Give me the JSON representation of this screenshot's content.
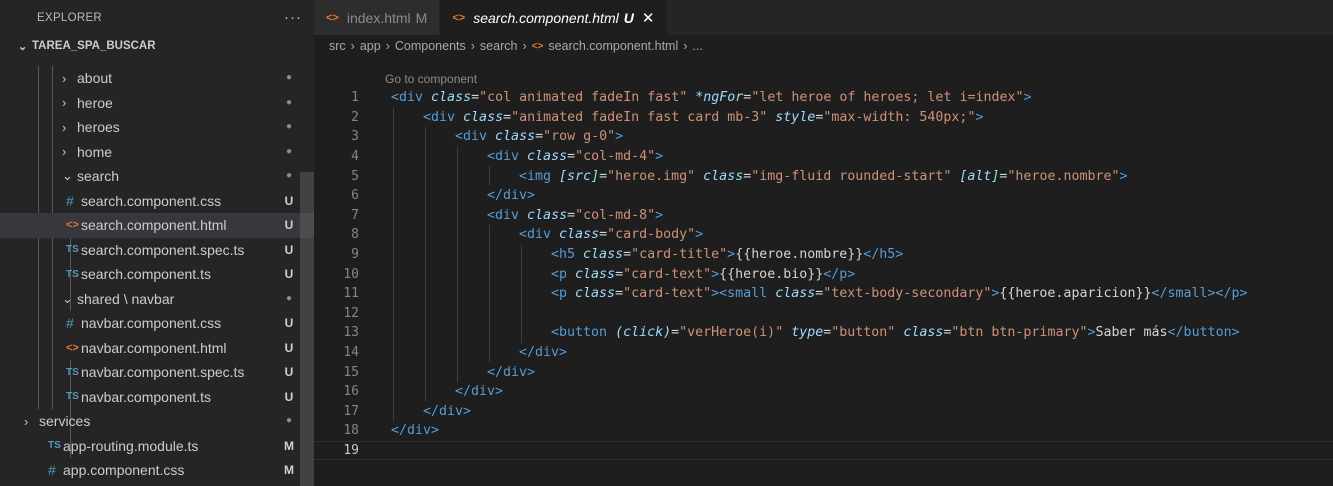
{
  "explorer": {
    "title": "EXPLORER",
    "more": "···",
    "workspace": "TAREA_SPA_BUSCAR"
  },
  "tree": [
    {
      "name": "about",
      "kind": "folder",
      "level": 1,
      "status": "dot",
      "open": false
    },
    {
      "name": "heroe",
      "kind": "folder",
      "level": 1,
      "status": "dot",
      "open": false
    },
    {
      "name": "heroes",
      "kind": "folder",
      "level": 1,
      "status": "dot",
      "open": false
    },
    {
      "name": "home",
      "kind": "folder",
      "level": 1,
      "status": "dot",
      "open": false
    },
    {
      "name": "search",
      "kind": "folder",
      "level": 1,
      "status": "dot",
      "open": true
    },
    {
      "name": "search.component.css",
      "kind": "css",
      "level": 2,
      "status": "U"
    },
    {
      "name": "search.component.html",
      "kind": "html",
      "level": 2,
      "status": "U",
      "selected": true
    },
    {
      "name": "search.component.spec.ts",
      "kind": "ts",
      "level": 2,
      "status": "U"
    },
    {
      "name": "search.component.ts",
      "kind": "ts",
      "level": 2,
      "status": "U"
    },
    {
      "name": "shared \\ navbar",
      "kind": "folder",
      "level": 1,
      "status": "dot",
      "open": true
    },
    {
      "name": "navbar.component.css",
      "kind": "css",
      "level": 2,
      "status": "U"
    },
    {
      "name": "navbar.component.html",
      "kind": "html",
      "level": 2,
      "status": "U"
    },
    {
      "name": "navbar.component.spec.ts",
      "kind": "ts",
      "level": 2,
      "status": "U"
    },
    {
      "name": "navbar.component.ts",
      "kind": "ts",
      "level": 2,
      "status": "U"
    },
    {
      "name": "services",
      "kind": "folder",
      "level": 0,
      "status": "dot",
      "open": false
    },
    {
      "name": "app-routing.module.ts",
      "kind": "ts",
      "level": -1,
      "status": "M"
    },
    {
      "name": "app.component.css",
      "kind": "css",
      "level": -1,
      "status": "M"
    }
  ],
  "tabs": [
    {
      "label": "index.html",
      "badge": "M",
      "active": false
    },
    {
      "label": "search.component.html",
      "badge": "U",
      "active": true,
      "close": "✕"
    }
  ],
  "breadcrumb": [
    "src",
    "app",
    "Components",
    "search",
    "search.component.html",
    "..."
  ],
  "codelens": "Go to component",
  "icons": {
    "ts": "TS",
    "css": "#",
    "html": "<>",
    "chevron_right": "›",
    "chevron_down": "⌄",
    "dot": "●",
    "close": "✕"
  },
  "code_lines": [
    {
      "n": "1",
      "indent": 0,
      "tokens": [
        [
          "tg",
          "<div"
        ],
        [
          "tx",
          " "
        ],
        [
          "at",
          "class"
        ],
        [
          "tx",
          "="
        ],
        [
          "st",
          "\"col animated fadeIn fast\""
        ],
        [
          "tx",
          " "
        ],
        [
          "at",
          "*ngFor"
        ],
        [
          "tx",
          "="
        ],
        [
          "st",
          "\"let heroe of heroes; let i=index\""
        ],
        [
          "tg",
          ">"
        ]
      ]
    },
    {
      "n": "2",
      "indent": 1,
      "tokens": [
        [
          "tg",
          "<div"
        ],
        [
          "tx",
          " "
        ],
        [
          "at",
          "class"
        ],
        [
          "tx",
          "="
        ],
        [
          "st",
          "\"animated fadeIn fast card mb-3\""
        ],
        [
          "tx",
          " "
        ],
        [
          "at",
          "style"
        ],
        [
          "tx",
          "="
        ],
        [
          "st",
          "\"max-width: 540px;\""
        ],
        [
          "tg",
          ">"
        ]
      ]
    },
    {
      "n": "3",
      "indent": 2,
      "tokens": [
        [
          "tg",
          "<div"
        ],
        [
          "tx",
          " "
        ],
        [
          "at",
          "class"
        ],
        [
          "tx",
          "="
        ],
        [
          "st",
          "\"row g-0\""
        ],
        [
          "tg",
          ">"
        ]
      ]
    },
    {
      "n": "4",
      "indent": 3,
      "tokens": [
        [
          "tg",
          "<div"
        ],
        [
          "tx",
          " "
        ],
        [
          "at",
          "class"
        ],
        [
          "tx",
          "="
        ],
        [
          "st",
          "\"col-md-4\""
        ],
        [
          "tg",
          ">"
        ]
      ]
    },
    {
      "n": "5",
      "indent": 4,
      "tokens": [
        [
          "tg",
          "<img"
        ],
        [
          "tx",
          " "
        ],
        [
          "at",
          "[src]"
        ],
        [
          "tx",
          "="
        ],
        [
          "st",
          "\"heroe.img\""
        ],
        [
          "tx",
          " "
        ],
        [
          "at",
          "class"
        ],
        [
          "tx",
          "="
        ],
        [
          "st",
          "\"img-fluid rounded-start\""
        ],
        [
          "tx",
          " "
        ],
        [
          "at",
          "[alt]"
        ],
        [
          "tx",
          "="
        ],
        [
          "st",
          "\"heroe.nombre\""
        ],
        [
          "tg",
          ">"
        ]
      ]
    },
    {
      "n": "6",
      "indent": 3,
      "tokens": [
        [
          "tg",
          "</div>"
        ]
      ]
    },
    {
      "n": "7",
      "indent": 3,
      "tokens": [
        [
          "tg",
          "<div"
        ],
        [
          "tx",
          " "
        ],
        [
          "at",
          "class"
        ],
        [
          "tx",
          "="
        ],
        [
          "st",
          "\"col-md-8\""
        ],
        [
          "tg",
          ">"
        ]
      ]
    },
    {
      "n": "8",
      "indent": 4,
      "tokens": [
        [
          "tg",
          "<div"
        ],
        [
          "tx",
          " "
        ],
        [
          "at",
          "class"
        ],
        [
          "tx",
          "="
        ],
        [
          "st",
          "\"card-body\""
        ],
        [
          "tg",
          ">"
        ]
      ]
    },
    {
      "n": "9",
      "indent": 5,
      "tokens": [
        [
          "tg",
          "<h5"
        ],
        [
          "tx",
          " "
        ],
        [
          "at",
          "class"
        ],
        [
          "tx",
          "="
        ],
        [
          "st",
          "\"card-title\""
        ],
        [
          "tg",
          ">"
        ],
        [
          "tx",
          "{{heroe.nombre}}"
        ],
        [
          "tg",
          "</h5>"
        ]
      ]
    },
    {
      "n": "10",
      "indent": 5,
      "tokens": [
        [
          "tg",
          "<p"
        ],
        [
          "tx",
          " "
        ],
        [
          "at",
          "class"
        ],
        [
          "tx",
          "="
        ],
        [
          "st",
          "\"card-text\""
        ],
        [
          "tg",
          ">"
        ],
        [
          "tx",
          "{{heroe.bio}}"
        ],
        [
          "tg",
          "</p>"
        ]
      ]
    },
    {
      "n": "11",
      "indent": 5,
      "tokens": [
        [
          "tg",
          "<p"
        ],
        [
          "tx",
          " "
        ],
        [
          "at",
          "class"
        ],
        [
          "tx",
          "="
        ],
        [
          "st",
          "\"card-text\""
        ],
        [
          "tg",
          "><small"
        ],
        [
          "tx",
          " "
        ],
        [
          "at",
          "class"
        ],
        [
          "tx",
          "="
        ],
        [
          "st",
          "\"text-body-secondary\""
        ],
        [
          "tg",
          ">"
        ],
        [
          "tx",
          "{{heroe.aparicion}}"
        ],
        [
          "tg",
          "</small></p>"
        ]
      ]
    },
    {
      "n": "12",
      "indent": 0,
      "tokens": []
    },
    {
      "n": "13",
      "indent": 5,
      "tokens": [
        [
          "tg",
          "<button"
        ],
        [
          "tx",
          " "
        ],
        [
          "at",
          "(click)"
        ],
        [
          "tx",
          "="
        ],
        [
          "st",
          "\"verHeroe(i)\""
        ],
        [
          "tx",
          " "
        ],
        [
          "at",
          "type"
        ],
        [
          "tx",
          "="
        ],
        [
          "st",
          "\"button\""
        ],
        [
          "tx",
          " "
        ],
        [
          "at",
          "class"
        ],
        [
          "tx",
          "="
        ],
        [
          "st",
          "\"btn btn-primary\""
        ],
        [
          "tg",
          ">"
        ],
        [
          "tx",
          "Saber más"
        ],
        [
          "tg",
          "</button>"
        ]
      ]
    },
    {
      "n": "14",
      "indent": 4,
      "tokens": [
        [
          "tg",
          "</div>"
        ]
      ]
    },
    {
      "n": "15",
      "indent": 3,
      "tokens": [
        [
          "tg",
          "</div>"
        ]
      ]
    },
    {
      "n": "16",
      "indent": 2,
      "tokens": [
        [
          "tg",
          "</div>"
        ]
      ]
    },
    {
      "n": "17",
      "indent": 1,
      "tokens": [
        [
          "tg",
          "</div>"
        ]
      ]
    },
    {
      "n": "18",
      "indent": 0,
      "tokens": [
        [
          "tg",
          "</div>"
        ]
      ]
    },
    {
      "n": "19",
      "indent": 0,
      "tokens": [],
      "current": true
    }
  ],
  "colors": {
    "tag": "#569cd6",
    "attribute": "#9cdcfe",
    "string": "#ce9178",
    "text": "#d4d4d4",
    "html_icon": "#e37933",
    "ts_icon": "#519aba"
  }
}
